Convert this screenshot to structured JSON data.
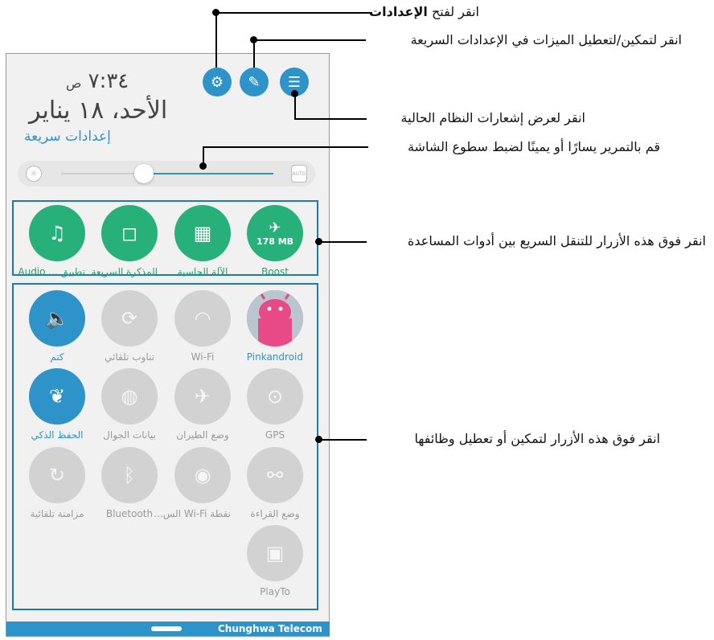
{
  "callouts": {
    "settings": "انقر لفتح",
    "settings_bold": "الإعدادات",
    "quick_features": "انقر لتمكين/لتعطيل الميزات في الإعدادات السريعة",
    "notifications": "انقر لعرض إشعارات النظام الحالية",
    "brightness": "قم بالتمرير يسارًا أو يمينًا لضبط سطوع الشاشة",
    "tools": "انقر فوق هذه الأزرار للتنقل السريع بين أدوات المساعدة",
    "toggles": "انقر فوق هذه الأزرار لتمكين أو تعطيل وظائفها"
  },
  "header": {
    "time": "٧:٣٤",
    "ampm": "ص",
    "date": "الأحد، ١٨ يناير",
    "quick_settings_label": "إعدادات سريعة"
  },
  "brightness": {
    "level": 0.39,
    "auto_label": "AUTO"
  },
  "tools": [
    {
      "label": "Boost",
      "sub": "178 MB",
      "icon": "rocket-icon"
    },
    {
      "label": "الآلة الحاسبة",
      "icon": "calculator-icon"
    },
    {
      "label": "المذكرة السريعة",
      "icon": "note-icon"
    },
    {
      "label": "تطبيق ... Audio",
      "icon": "audio-settings-icon"
    }
  ],
  "toggles": [
    {
      "label": "Pinkandroid",
      "icon": "avatar-icon",
      "active": true
    },
    {
      "label": "Wi-Fi",
      "icon": "wifi-icon",
      "active": false
    },
    {
      "label": "تناوب تلقائي",
      "icon": "auto-rotate-icon",
      "active": false
    },
    {
      "label": "كتم",
      "icon": "mute-icon",
      "active": true
    },
    {
      "label": "GPS",
      "icon": "gps-icon",
      "active": false
    },
    {
      "label": "وضع الطيران",
      "icon": "airplane-icon",
      "active": false
    },
    {
      "label": "بيانات الجوال",
      "icon": "mobile-data-icon",
      "active": false
    },
    {
      "label": "الحفظ الذكي",
      "icon": "leaf-icon",
      "active": true
    },
    {
      "label": "وضع القراءة",
      "icon": "glasses-icon",
      "active": false
    },
    {
      "label": "نقطة Wi-Fi الس...",
      "icon": "hotspot-icon",
      "active": false
    },
    {
      "label": "Bluetooth",
      "icon": "bluetooth-icon",
      "active": false
    },
    {
      "label": "مزامنة تلقائية",
      "icon": "sync-icon",
      "active": false
    },
    {
      "label": "PlayTo",
      "icon": "playto-icon",
      "active": false
    }
  ],
  "footer": {
    "carrier": "Chunghwa Telecom"
  },
  "colors": {
    "accent": "#2e93c9",
    "tool_green": "#27b07a",
    "box": "#1c79c0"
  }
}
